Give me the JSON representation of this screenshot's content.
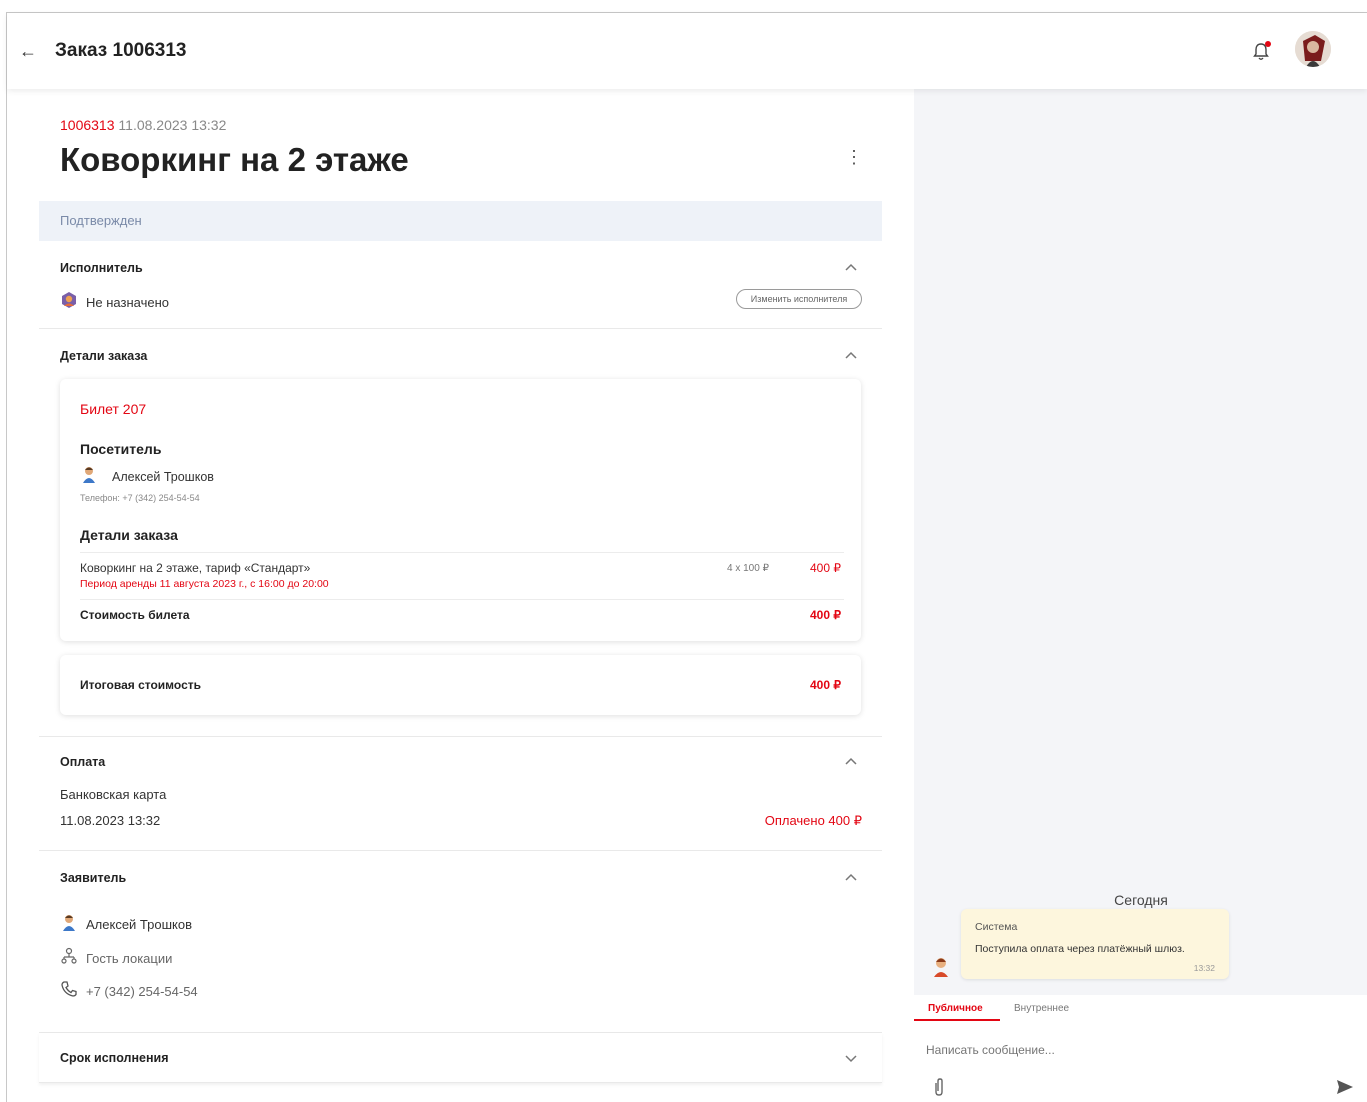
{
  "header": {
    "back_icon": "arrow-left-icon",
    "title": "Заказ 1006313"
  },
  "order": {
    "number": "1006313",
    "datetime": "11.08.2023 13:32",
    "title": "Коворкинг на 2 этаже",
    "status": "Подтвержден"
  },
  "executor": {
    "title": "Исполнитель",
    "value": "Не назначено",
    "change_button": "Изменить исполнителя"
  },
  "details": {
    "title": "Детали заказа",
    "ticket": {
      "label": "Билет 207",
      "visitor_heading": "Посетитель",
      "visitor_name": "Алексей Трошков",
      "visitor_phone": "Телефон: +7 (342) 254-54-54",
      "details_heading": "Детали заказа",
      "item_name": "Коворкинг на 2 этаже, тариф «Стандарт»",
      "item_period": "Период аренды 11 августа 2023 г., с 16:00 до 20:00",
      "item_qty": "4 x 100 ₽",
      "item_price": "400 ₽",
      "ticket_cost_label": "Стоимость билета",
      "ticket_cost_value": "400 ₽"
    },
    "total_label": "Итоговая стоимость",
    "total_value": "400 ₽"
  },
  "payment": {
    "title": "Оплата",
    "method": "Банковская карта",
    "datetime": "11.08.2023 13:32",
    "status": "Оплачено 400 ₽"
  },
  "applicant": {
    "title": "Заявитель",
    "name": "Алексей Трошков",
    "role": "Гость локации",
    "phone": "+7 (342) 254-54-54"
  },
  "deadline": {
    "title": "Срок исполнения"
  },
  "chat": {
    "day_label": "Сегодня",
    "message": {
      "author": "Система",
      "text": "Поступила оплата через платёжный шлюз.",
      "time": "13:32"
    },
    "tabs": [
      "Публичное",
      "Внутреннее"
    ],
    "active_tab": "Публичное",
    "input_placeholder": "Написать сообщение..."
  },
  "colors": {
    "accent": "#e30613",
    "status_bg": "#eef2f8",
    "bubble_bg": "#fdf6dd"
  }
}
